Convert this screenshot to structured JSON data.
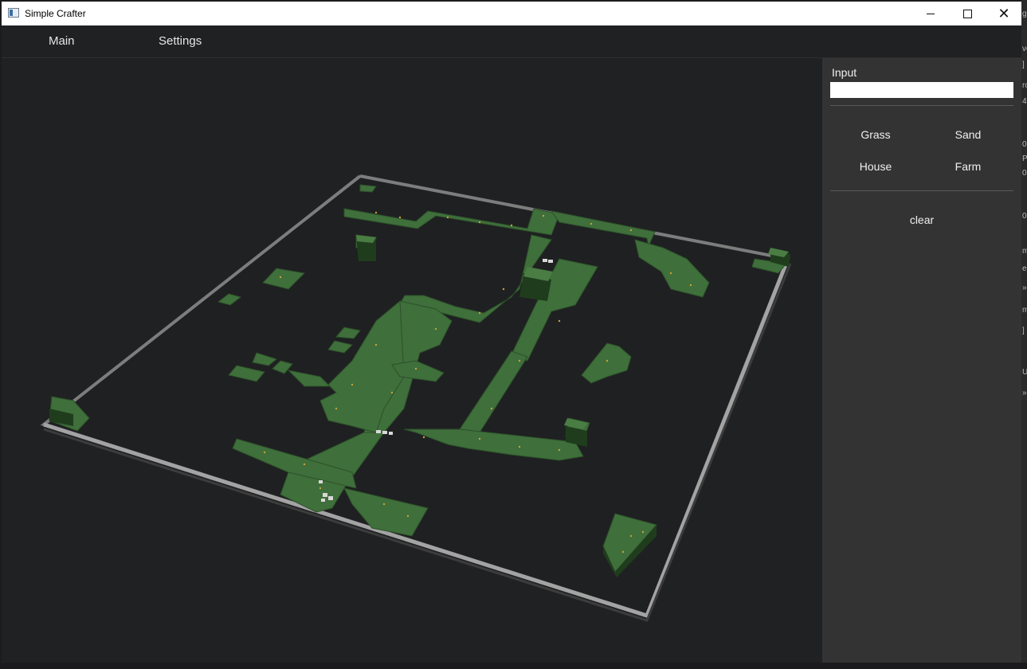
{
  "window": {
    "title": "Simple Crafter",
    "controls": {
      "minimize": "minimize-icon",
      "maximize": "maximize-icon",
      "close": "close-icon"
    }
  },
  "menu": {
    "main": "Main",
    "settings": "Settings"
  },
  "panel": {
    "input_label": "Input",
    "input_value": "",
    "tools": {
      "grass": "Grass",
      "sand": "Sand",
      "house": "House",
      "farm": "Farm"
    },
    "clear": "clear"
  },
  "background_fragments": [
    "ve",
    "]",
    "ro",
    "4",
    "0",
    "P",
    "0",
    "0",
    "m",
    "er",
    "»",
    "m",
    "]",
    "U",
    "»",
    "g"
  ],
  "colors": {
    "viewport_bg": "#202123",
    "panel_bg": "#333334",
    "grass": "#3f6f3b",
    "grass_side": "#1f3d1d",
    "border_wall": "#8a8a8a"
  }
}
